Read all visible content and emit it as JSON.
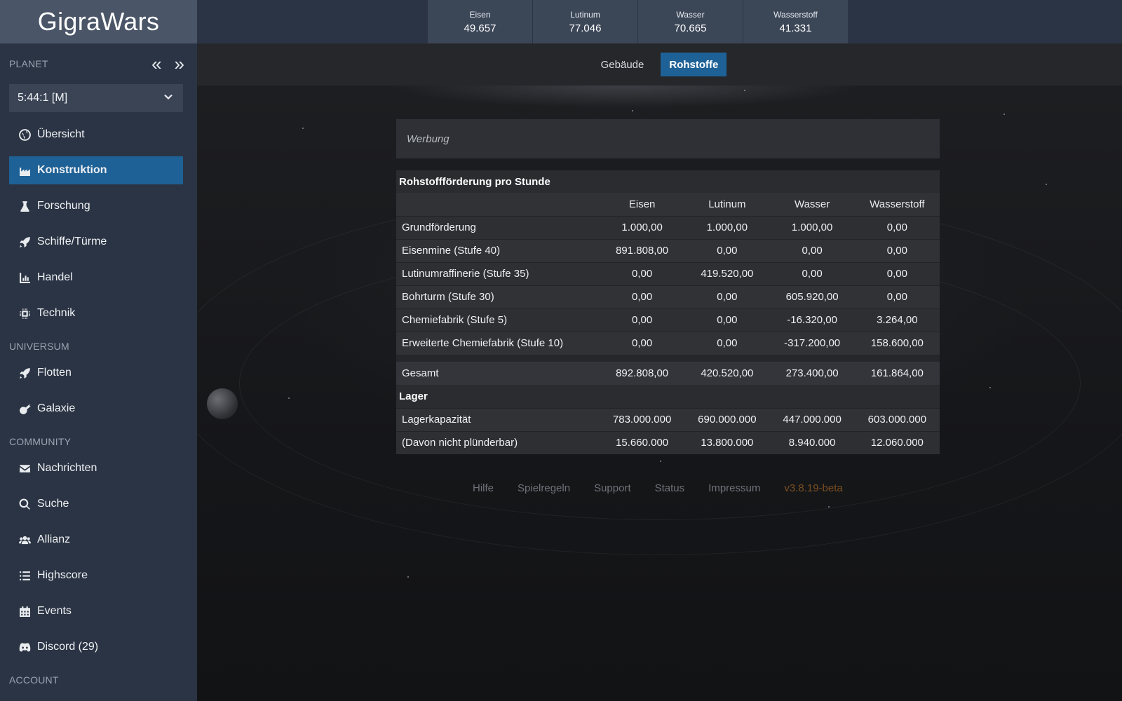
{
  "app": {
    "title": "GigraWars"
  },
  "sidebar": {
    "planet_label": "PLANET",
    "planet_selected": "5:44:1 [M]",
    "items": [
      {
        "label": "Übersicht",
        "icon": "globe-icon"
      },
      {
        "label": "Konstruktion",
        "icon": "factory-icon",
        "active": true
      },
      {
        "label": "Forschung",
        "icon": "flask-icon"
      },
      {
        "label": "Schiffe/Türme",
        "icon": "rocket-icon"
      },
      {
        "label": "Handel",
        "icon": "chart-icon"
      },
      {
        "label": "Technik",
        "icon": "chip-icon"
      }
    ],
    "universe_label": "UNIVERSUM",
    "universe_items": [
      {
        "label": "Flotten",
        "icon": "rocket-icon"
      },
      {
        "label": "Galaxie",
        "icon": "meteor-icon"
      }
    ],
    "community_label": "COMMUNITY",
    "community_items": [
      {
        "label": "Nachrichten",
        "icon": "envelope-icon"
      },
      {
        "label": "Suche",
        "icon": "search-icon"
      },
      {
        "label": "Allianz",
        "icon": "users-icon"
      },
      {
        "label": "Highscore",
        "icon": "list-icon"
      },
      {
        "label": "Events",
        "icon": "calendar-icon"
      },
      {
        "label": "Discord (29)",
        "icon": "discord-icon"
      }
    ],
    "account_label": "ACCOUNT"
  },
  "resources": [
    {
      "name": "Eisen",
      "value": "49.657"
    },
    {
      "name": "Lutinum",
      "value": "77.046"
    },
    {
      "name": "Wasser",
      "value": "70.665"
    },
    {
      "name": "Wasserstoff",
      "value": "41.331"
    }
  ],
  "tabs": [
    {
      "label": "Gebäude"
    },
    {
      "label": "Rohstoffe",
      "active": true
    }
  ],
  "ad_label": "Werbung",
  "production": {
    "title": "Rohstoffförderung pro Stunde",
    "columns": [
      "Eisen",
      "Lutinum",
      "Wasser",
      "Wasserstoff"
    ],
    "rows": [
      {
        "label": "Grundförderung",
        "values": [
          "1.000,00",
          "1.000,00",
          "1.000,00",
          "0,00"
        ]
      },
      {
        "label": "Eisenmine (Stufe 40)",
        "values": [
          "891.808,00",
          "0,00",
          "0,00",
          "0,00"
        ]
      },
      {
        "label": "Lutinumraffinerie (Stufe 35)",
        "values": [
          "0,00",
          "419.520,00",
          "0,00",
          "0,00"
        ]
      },
      {
        "label": "Bohrturm (Stufe 30)",
        "values": [
          "0,00",
          "0,00",
          "605.920,00",
          "0,00"
        ]
      },
      {
        "label": "Chemiefabrik (Stufe 5)",
        "values": [
          "0,00",
          "0,00",
          "-16.320,00",
          "3.264,00"
        ]
      },
      {
        "label": "Erweiterte Chemiefabrik (Stufe 10)",
        "values": [
          "0,00",
          "0,00",
          "-317.200,00",
          "158.600,00"
        ]
      }
    ],
    "total": {
      "label": "Gesamt",
      "values": [
        "892.808,00",
        "420.520,00",
        "273.400,00",
        "161.864,00"
      ]
    }
  },
  "storage": {
    "title": "Lager",
    "rows": [
      {
        "label": "Lagerkapazität",
        "values": [
          "783.000.000",
          "690.000.000",
          "447.000.000",
          "603.000.000"
        ]
      },
      {
        "label": "(Davon nicht plünderbar)",
        "values": [
          "15.660.000",
          "13.800.000",
          "8.940.000",
          "12.060.000"
        ]
      }
    ]
  },
  "footer": {
    "links": [
      "Hilfe",
      "Spielregeln",
      "Support",
      "Status",
      "Impressum"
    ],
    "version": "v3.8.19-beta"
  },
  "colors": {
    "accent": "#1e6196",
    "sidebar": "#2b3444",
    "version": "#7a4f22"
  }
}
